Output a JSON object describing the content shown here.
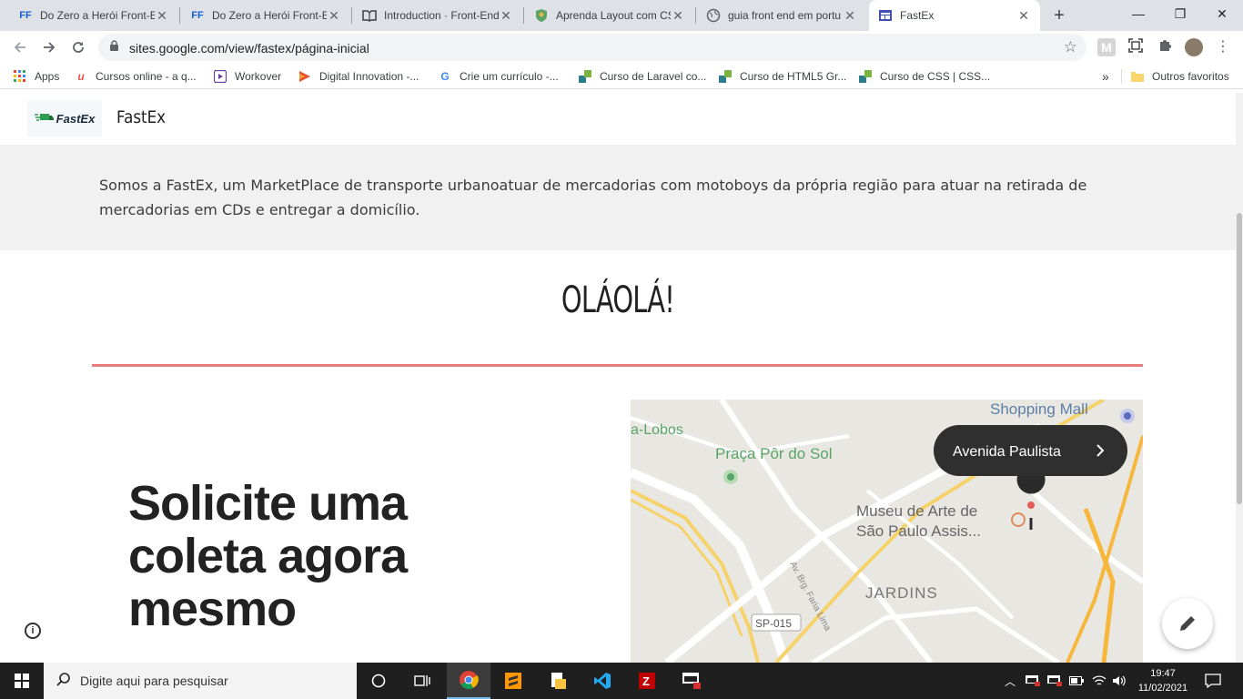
{
  "browser": {
    "tabs": [
      {
        "title": "Do Zero a Herói Front-E",
        "icon": "FF",
        "active": false
      },
      {
        "title": "Do Zero a Herói Front-E",
        "icon": "FF",
        "active": false
      },
      {
        "title": "Introduction · Front-End",
        "icon": "book-icon",
        "active": false
      },
      {
        "title": "Aprenda Layout com CS",
        "icon": "shield-icon",
        "active": false
      },
      {
        "title": "guia front end em portu",
        "icon": "globe-icon",
        "active": false
      },
      {
        "title": "FastEx",
        "icon": "sites-icon",
        "active": true
      }
    ],
    "url": "sites.google.com/view/fastex/página-inicial",
    "bookmarks": [
      {
        "label": "Apps",
        "icon": "apps-grid-icon"
      },
      {
        "label": "Cursos online - a q...",
        "icon": "udemy-icon"
      },
      {
        "label": "Workover",
        "icon": "play-icon"
      },
      {
        "label": "Digital Innovation -...",
        "icon": "dio-icon"
      },
      {
        "label": "Crie um currículo -...",
        "icon": "google-icon"
      },
      {
        "label": "Curso de Laravel co...",
        "icon": "course-icon"
      },
      {
        "label": "Curso de HTML5 Gr...",
        "icon": "course-icon"
      },
      {
        "label": "Curso de CSS | CSS...",
        "icon": "course-icon"
      }
    ],
    "other_bookmarks": "Outros favoritos",
    "more_bookmarks": "»"
  },
  "site": {
    "name": "FastEx",
    "logo_text": "FastEx",
    "intro": "Somos a FastEx, um MarketPlace de transporte urbanoatuar de mercadorias com motoboys da própria região para atuar  na retirada de mercadorias em CDs e entregar a domicílio.",
    "heading": "OLÁOLÁ!",
    "cta": "Solicite uma coleta agora mesmo",
    "accent_color": "#e87c7c"
  },
  "map": {
    "labels": {
      "mall": "Shopping Mall",
      "lobos": "a-Lobos",
      "praca": "Praça Pôr do Sol",
      "avenida": "Avenida Paulista",
      "museu1": "Museu de Arte de",
      "museu2": "São Paulo Assis...",
      "jardins": "JARDINS",
      "sp015": "SP-015",
      "faria": "Av. Brg. Faria Lima"
    }
  },
  "taskbar": {
    "search_placeholder": "Digite aqui para pesquisar",
    "time": "19:47",
    "date": "11/02/2021"
  }
}
